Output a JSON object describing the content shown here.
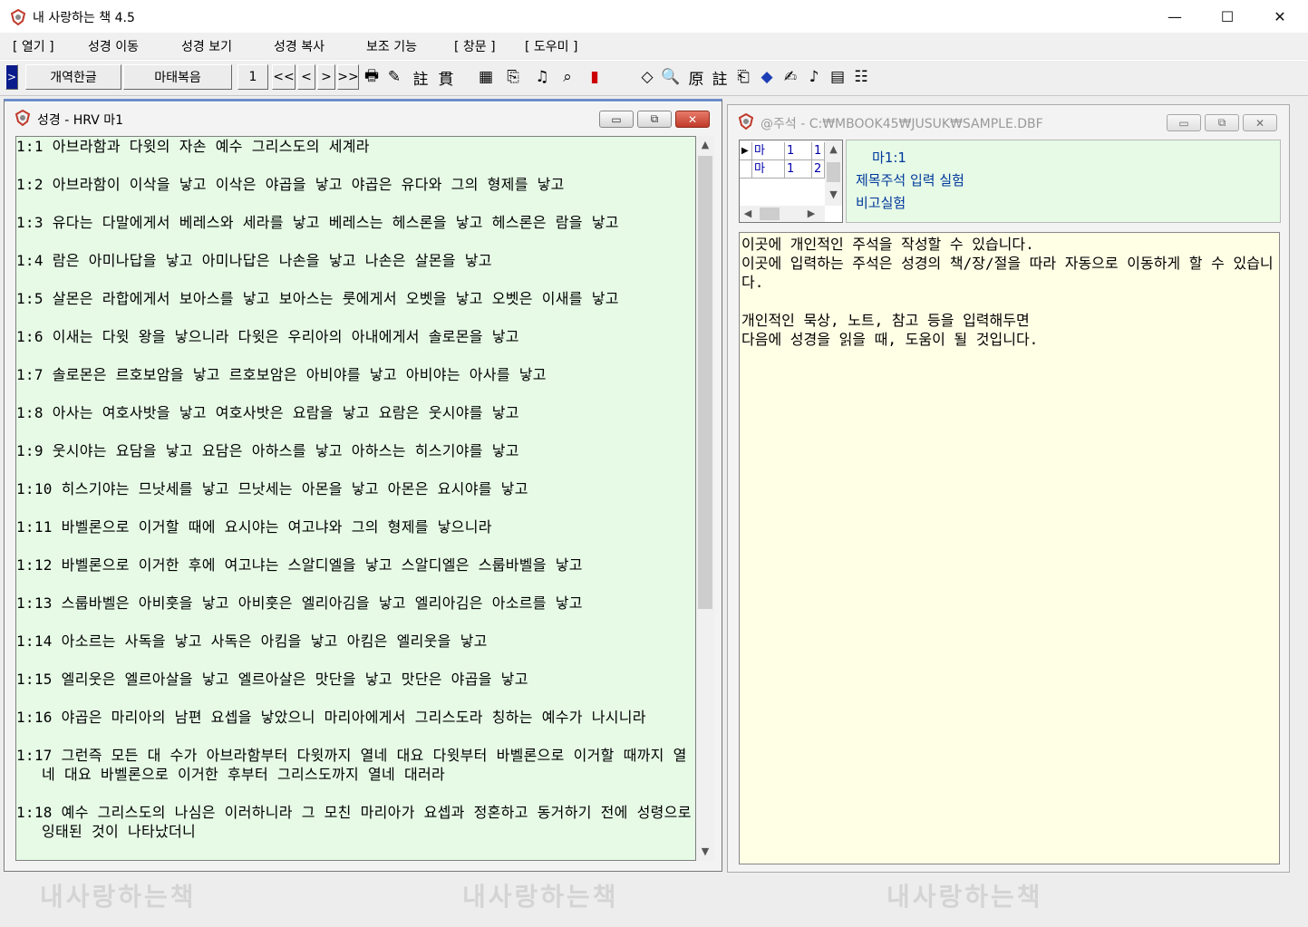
{
  "window": {
    "title": "내 사랑하는 책 4.5",
    "minimize": "—",
    "maximize": "☐",
    "close": "✕"
  },
  "menu": [
    "[ 열기 ]",
    "성경 이동",
    "성경 보기",
    "성경 복사",
    "보조 기능",
    "[ 창문 ]",
    "[ 도우미 ]"
  ],
  "toolbar": {
    "translation": "개역한글",
    "book": "마태복음",
    "chapter": "1",
    "nav_first": "<<",
    "nav_prev": "<",
    "nav_next": ">",
    "nav_last": ">>",
    "glyph_note": "註",
    "glyph_through": "貫",
    "glyph_orig": "原",
    "glyph_note2": "註"
  },
  "bible_window": {
    "title": "성경 - HRV 마1",
    "verses": [
      {
        "ref": "1:1",
        "text": "아브라함과 다윗의 자손 예수 그리스도의 세계라"
      },
      {
        "ref": "1:2",
        "text": "아브라함이 이삭을 낳고 이삭은 야곱을 낳고 야곱은 유다와 그의 형제를 낳고"
      },
      {
        "ref": "1:3",
        "text": "유다는 다말에게서 베레스와 세라를 낳고 베레스는 헤스론을 낳고 헤스론은 람을 낳고"
      },
      {
        "ref": "1:4",
        "text": "람은 아미나답을 낳고 아미나답은 나손을 낳고 나손은 살몬을 낳고"
      },
      {
        "ref": "1:5",
        "text": "살몬은 라합에게서 보아스를 낳고 보아스는 룻에게서 오벳을 낳고 오벳은 이새를 낳고"
      },
      {
        "ref": "1:6",
        "text": "이새는 다윗 왕을 낳으니라 다윗은 우리아의 아내에게서 솔로몬을 낳고"
      },
      {
        "ref": "1:7",
        "text": "솔로몬은 르호보암을 낳고 르호보암은 아비야를 낳고 아비야는 아사를 낳고"
      },
      {
        "ref": "1:8",
        "text": "아사는 여호사밧을 낳고 여호사밧은 요람을 낳고 요람은 웃시야를 낳고"
      },
      {
        "ref": "1:9",
        "text": "웃시야는 요담을 낳고 요담은 아하스를 낳고 아하스는 히스기야를 낳고"
      },
      {
        "ref": "1:10",
        "text": "히스기야는 므낫세를 낳고 므낫세는 아몬을 낳고 아몬은 요시야를 낳고"
      },
      {
        "ref": "1:11",
        "text": "바벨론으로 이거할 때에 요시야는 여고냐와 그의 형제를 낳으니라"
      },
      {
        "ref": "1:12",
        "text": "바벨론으로 이거한 후에 여고냐는 스알디엘을 낳고 스알디엘은 스룹바벨을 낳고"
      },
      {
        "ref": "1:13",
        "text": "스룹바벨은 아비훗을 낳고 아비훗은 엘리아김을 낳고 엘리아김은 아소르를 낳고"
      },
      {
        "ref": "1:14",
        "text": "아소르는 사독을 낳고 사독은 아킴을 낳고 아킴은 엘리웃을 낳고"
      },
      {
        "ref": "1:15",
        "text": "엘리웃은 엘르아살을 낳고 엘르아살은 맛단을 낳고 맛단은 야곱을 낳고"
      },
      {
        "ref": "1:16",
        "text": "야곱은 마리아의 남편 요셉을 낳았으니 마리아에게서 그리스도라 칭하는 예수가 나시니라"
      },
      {
        "ref": "1:17",
        "text": "그런즉 모든 대 수가 아브라함부터 다윗까지 열네 대요 다윗부터 바벨론으로 이거할 때까지 열네 대요 바벨론으로 이거한 후부터 그리스도까지 열네 대러라"
      },
      {
        "ref": "1:18",
        "text": "예수 그리스도의 나심은 이러하니라 그 모친 마리아가 요셉과 정혼하고 동거하기 전에 성령으로 잉태된 것이 나타났더니"
      }
    ]
  },
  "note_window": {
    "title": "@주석 - C:₩MBOOK45₩JUSUK₩SAMPLE.DBF",
    "grid": [
      [
        "마",
        "1",
        "1"
      ],
      [
        "마",
        "1",
        "2"
      ]
    ],
    "ref_title": "마1:1",
    "ref_lines": [
      "제목주석 입력 실험",
      "비고실험"
    ],
    "body": "이곳에 개인적인 주석을 작성할 수 있습니다.\n이곳에 입력하는 주석은 성경의 책/장/절을 따라 자동으로 이동하게 할 수 있습니다.\n\n개인적인 묵상, 노트, 참고 등을 입력해두면\n다음에 성경을 읽을 때, 도움이 될 것입니다."
  },
  "watermark": "내사랑하는책"
}
